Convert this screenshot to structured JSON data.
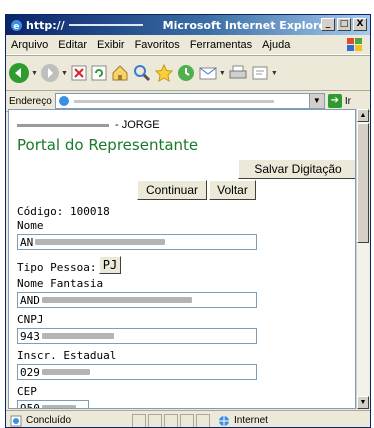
{
  "window": {
    "url_prefix": "http://",
    "app_title": "Microsoft Internet Explorer",
    "btn_min": "_",
    "btn_max": "□",
    "btn_close": "X"
  },
  "menu": {
    "items": [
      {
        "label": "Arquivo"
      },
      {
        "label": "Editar"
      },
      {
        "label": "Exibir"
      },
      {
        "label": "Favoritos"
      },
      {
        "label": "Ferramentas"
      },
      {
        "label": "Ajuda"
      }
    ]
  },
  "toolbar": {
    "icons": [
      "back-icon",
      "forward-icon",
      "stop-icon",
      "refresh-icon",
      "home-icon",
      "search-icon",
      "favorites-icon",
      "history-icon",
      "mail-icon",
      "print-icon",
      "edit-icon"
    ]
  },
  "address": {
    "label": "Endereço",
    "go_label": "Ir"
  },
  "page": {
    "user_suffix": "- JORGE",
    "title": "Portal do Representante",
    "salvar_label": "Salvar Digitação",
    "continuar_label": "Continuar",
    "voltar_label": "Voltar",
    "codigo_line": "Código: 100018",
    "nome_label": "Nome",
    "nome_value": "AN",
    "tipo_label": "Tipo Pessoa:",
    "tipo_value": "PJ",
    "fantasia_label": "Nome Fantasia",
    "fantasia_value": "AND",
    "cnpj_label": "CNPJ",
    "cnpj_value": "943",
    "ie_label": "Inscr. Estadual",
    "ie_value": "029",
    "cep_label": "CEP",
    "cep_value": "950"
  },
  "status": {
    "left": "Concluído",
    "zone": "Internet"
  },
  "colors": {
    "title_green": "#1a7a2a",
    "titlebar_start": "#0a246a",
    "titlebar_end": "#a6caf0"
  }
}
